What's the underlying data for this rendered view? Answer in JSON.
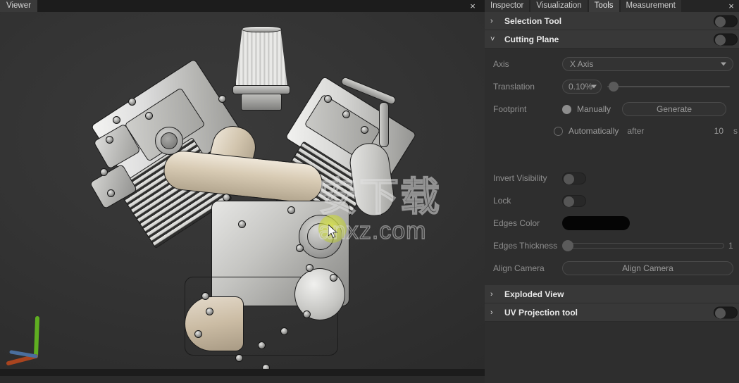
{
  "viewer": {
    "tab_label": "Viewer",
    "close_icon": "×",
    "watermark_cjk": "安下载",
    "watermark_url": "anxz.com",
    "gizmo": {
      "y_axis_color": "#5fae21",
      "x_axis_color": "#a8441f",
      "z_axis_color": "#4a6f9e"
    },
    "background_color": "#2e2e2e",
    "selection_highlight_color": "#d7e150"
  },
  "panel": {
    "tabs": [
      {
        "label": "Inspector",
        "active": false
      },
      {
        "label": "Visualization",
        "active": false
      },
      {
        "label": "Tools",
        "active": true
      },
      {
        "label": "Measurement",
        "active": false
      }
    ],
    "close_icon": "×",
    "sections": [
      {
        "title": "Selection Tool",
        "expanded": false,
        "chevron": "›",
        "has_toggle": true,
        "toggle_on": false
      },
      {
        "title": "Cutting Plane",
        "expanded": true,
        "chevron": "˅",
        "has_toggle": true,
        "toggle_on": false
      },
      {
        "title": "Exploded View",
        "expanded": false,
        "chevron": "›",
        "has_toggle": false,
        "toggle_on": false
      },
      {
        "title": "UV Projection tool",
        "expanded": false,
        "chevron": "›",
        "has_toggle": true,
        "toggle_on": false
      }
    ],
    "cutting_plane": {
      "axis": {
        "label": "Axis",
        "value": "X Axis"
      },
      "translation": {
        "label": "Translation",
        "value": "0.10%",
        "slider_percent": 2
      },
      "footprint": {
        "label": "Footprint",
        "manually_label": "Manually",
        "manually_selected": true,
        "generate_label": "Generate",
        "automatically_label": "Automatically",
        "automatically_selected": false,
        "after_label": "after",
        "after_value": "10",
        "after_unit": "s"
      },
      "invert_visibility": {
        "label": "Invert Visibility",
        "on": false
      },
      "lock": {
        "label": "Lock",
        "on": false
      },
      "edges_color": {
        "label": "Edges Color",
        "value": "#050505"
      },
      "edges_thickness": {
        "label": "Edges Thickness",
        "value": "1",
        "slider_percent": 0
      },
      "align_camera": {
        "label": "Align Camera",
        "button_label": "Align Camera"
      }
    }
  }
}
